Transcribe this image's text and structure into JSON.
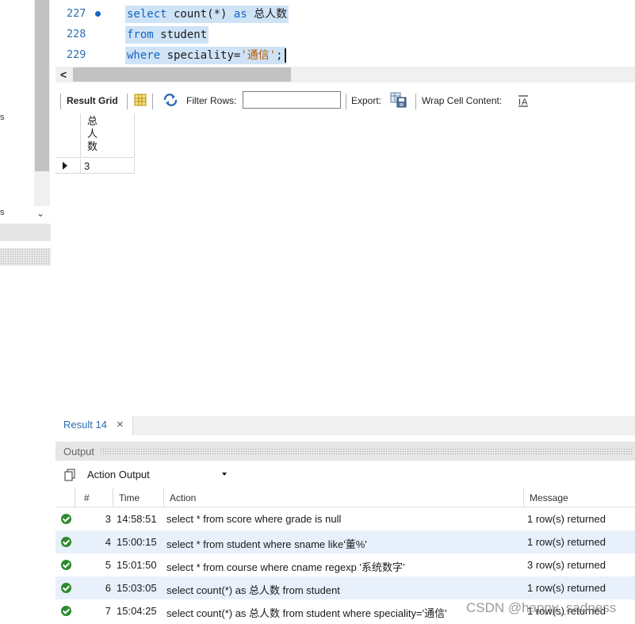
{
  "editor": {
    "lines": [
      {
        "num": "227",
        "kw1": "select",
        "p1": " count(*) ",
        "kw2": "as",
        "p2": " 总人数"
      },
      {
        "num": "228",
        "kw1": "from",
        "p1": " student"
      },
      {
        "num": "229",
        "kw1": "where",
        "p1": " speciality=",
        "str": "'通信'",
        "p2": ";"
      }
    ]
  },
  "result_toolbar": {
    "result_grid_label": "Result Grid",
    "filter_rows_label": "Filter Rows:",
    "filter_rows_value": "",
    "export_label": "Export:",
    "wrap_label": "Wrap Cell Content:"
  },
  "grid": {
    "columns": [
      "总人数"
    ],
    "rows": [
      [
        "3"
      ]
    ]
  },
  "result_tab": {
    "label": "Result 14",
    "close": "×"
  },
  "output": {
    "title": "Output",
    "action_select": "Action Output",
    "headers": {
      "num": "#",
      "time": "Time",
      "action": "Action",
      "message": "Message"
    },
    "rows": [
      {
        "num": "3",
        "time": "14:58:51",
        "action": "select * from score where grade is null",
        "message": "1 row(s) returned"
      },
      {
        "num": "4",
        "time": "15:00:15",
        "action": "select * from student where sname like'董%'",
        "message": "1 row(s) returned"
      },
      {
        "num": "5",
        "time": "15:01:50",
        "action": "select * from course where cname regexp '系统数字'",
        "message": "3 row(s) returned"
      },
      {
        "num": "6",
        "time": "15:03:05",
        "action": "select count(*) as 总人数 from student",
        "message": "1 row(s) returned"
      },
      {
        "num": "7",
        "time": "15:04:25",
        "action": "select count(*) as 总人数 from student where speciality='通信'",
        "message": "1 row(s) returned"
      }
    ]
  },
  "watermark": "CSDN @happy_sadness",
  "colors": {
    "keyword": "#1565c0",
    "selection": "#cfe3f7",
    "success": "#2e8b2e",
    "alt_row": "#e8f0fb"
  }
}
